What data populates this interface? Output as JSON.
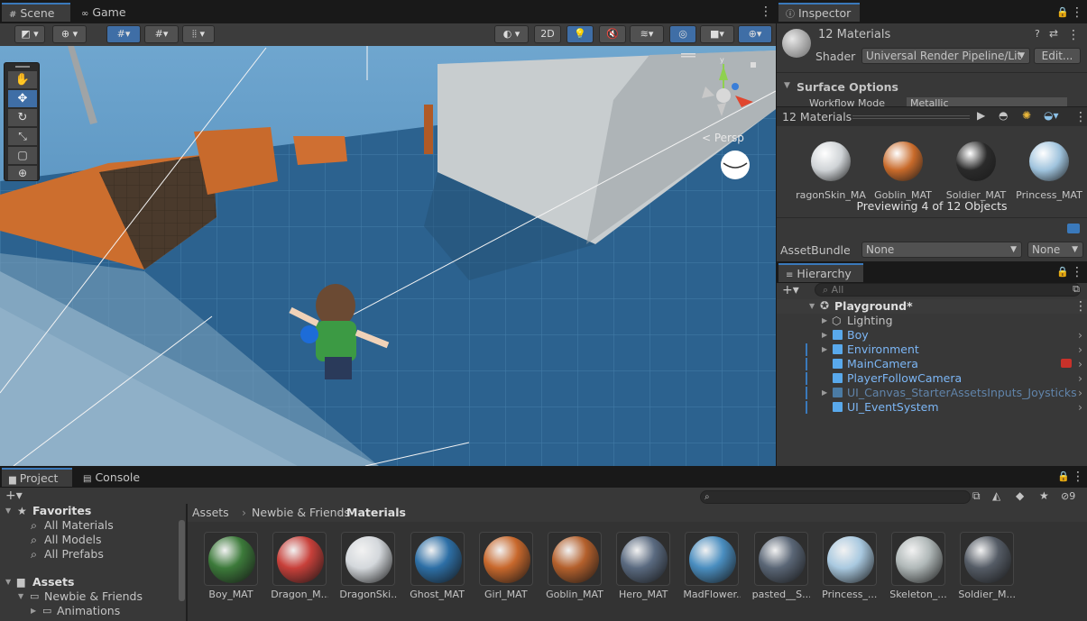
{
  "scene_tabs": {
    "scene": "Scene",
    "game": "Game"
  },
  "scene_toolbar": {
    "btn_2d": "2D"
  },
  "scene_view": {
    "persp_label": "< Persp",
    "gizmo_y": "y"
  },
  "inspector": {
    "tab": "Inspector",
    "title": "12 Materials",
    "shader_label": "Shader",
    "shader_value": "Universal Render Pipeline/Lit",
    "edit_button": "Edit...",
    "surface_options": "Surface Options",
    "workflow_label": "Workflow Mode",
    "workflow_value": "Metallic",
    "preview_title": "12 Materials",
    "previews": [
      {
        "name": "ragonSkin_MA",
        "color": "#cfd3d6"
      },
      {
        "name": "Goblin_MAT",
        "color": "#c86a2a"
      },
      {
        "name": "Soldier_MAT",
        "color": "#2a2a2a"
      },
      {
        "name": "Princess_MAT",
        "color": "#9fc3dd"
      }
    ],
    "previewing_text": "Previewing 4 of 12 Objects",
    "assetbundle_label": "AssetBundle",
    "assetbundle_value": "None",
    "assetbundle_variant": "None"
  },
  "hierarchy": {
    "tab": "Hierarchy",
    "search_placeholder": "All",
    "scene_name": "Playground*",
    "items": [
      {
        "label": "Lighting"
      },
      {
        "label": "Boy"
      },
      {
        "label": "Environment"
      },
      {
        "label": "MainCamera"
      },
      {
        "label": "PlayerFollowCamera"
      },
      {
        "label": "UI_Canvas_StarterAssetsInputs_Joysticks"
      },
      {
        "label": "UI_EventSystem"
      }
    ]
  },
  "project": {
    "tab_project": "Project",
    "tab_console": "Console",
    "hidden_count": "9",
    "favorites": "Favorites",
    "fav_items": [
      "All Materials",
      "All Models",
      "All Prefabs"
    ],
    "assets_root": "Assets",
    "tree_items": [
      "Newbie & Friends",
      "Animations"
    ],
    "breadcrumb": [
      "Assets",
      "Newbie & Friends",
      "Materials"
    ],
    "assets": [
      {
        "name": "Boy_MAT",
        "color": "#3c7a3a"
      },
      {
        "name": "Dragon_M...",
        "color": "#c8403a"
      },
      {
        "name": "DragonSki...",
        "color": "#d4d8dc"
      },
      {
        "name": "Ghost_MAT",
        "color": "#2d6fa6"
      },
      {
        "name": "Girl_MAT",
        "color": "#c8682c"
      },
      {
        "name": "Goblin_MAT",
        "color": "#b4602c"
      },
      {
        "name": "Hero_MAT",
        "color": "#5a6a80"
      },
      {
        "name": "MadFlower...",
        "color": "#4a8ec0"
      },
      {
        "name": "pasted__S...",
        "color": "#5a6676"
      },
      {
        "name": "Princess_...",
        "color": "#a9c9e0"
      },
      {
        "name": "Skeleton_...",
        "color": "#b0b8b8"
      },
      {
        "name": "Soldier_M...",
        "color": "#555c66"
      }
    ]
  }
}
